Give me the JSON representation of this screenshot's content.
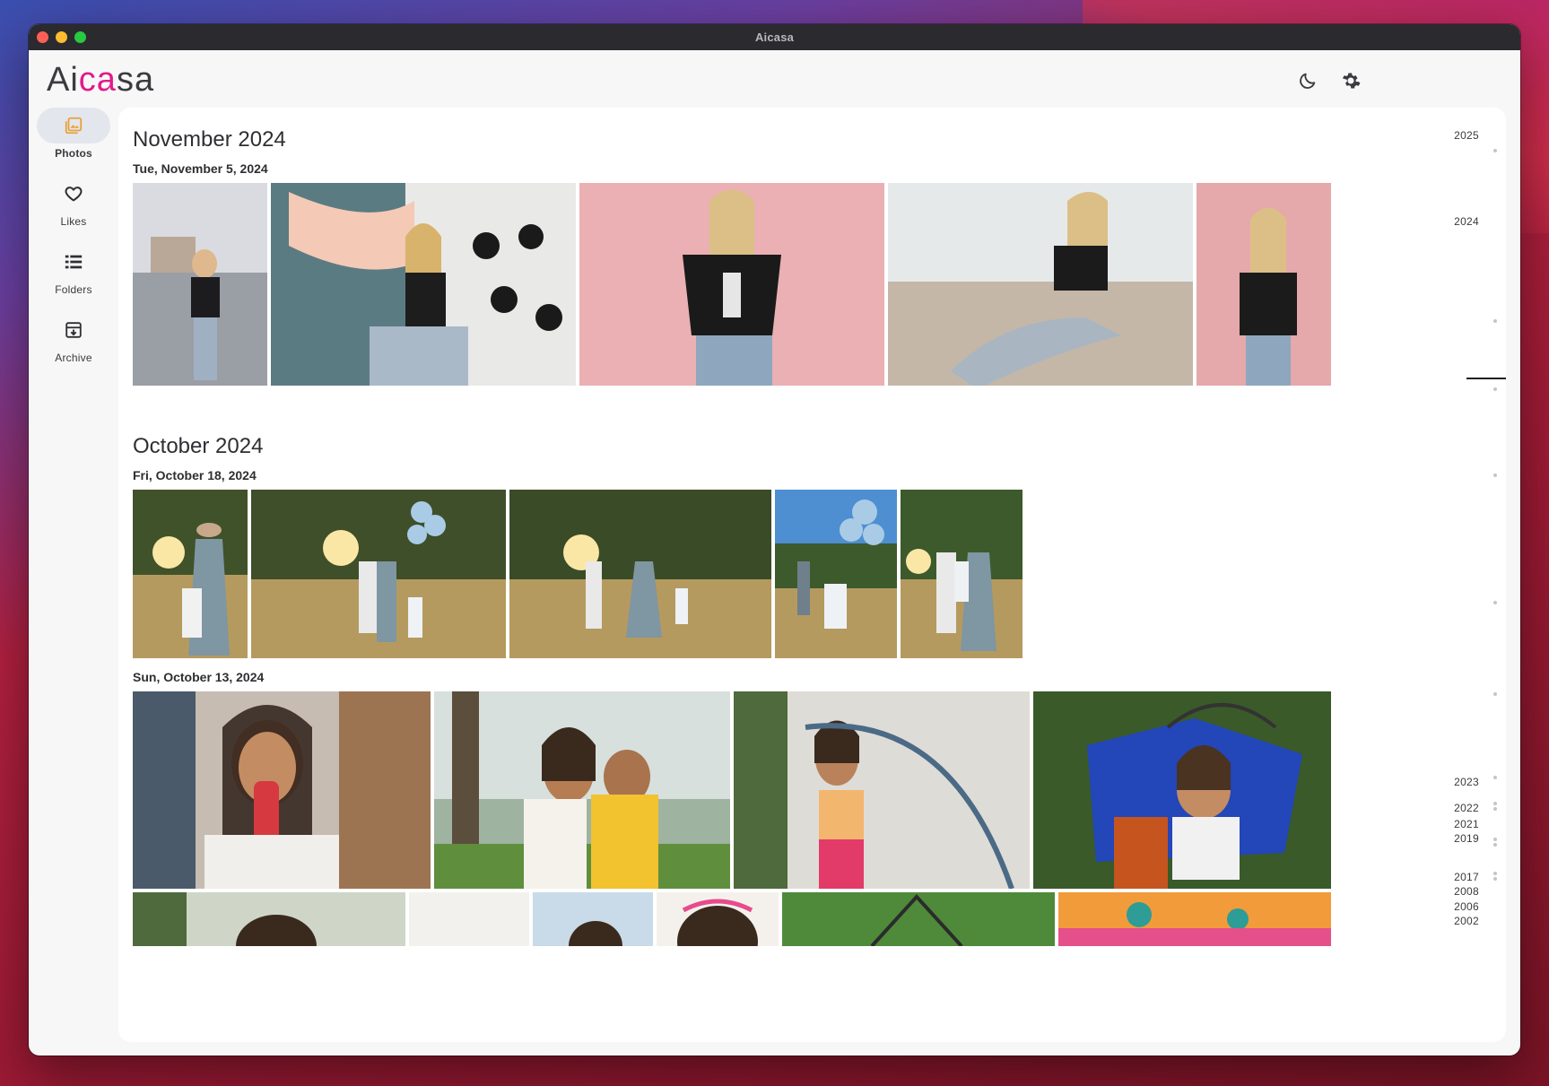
{
  "window": {
    "title": "Aicasa"
  },
  "app": {
    "logo": {
      "part1": "Ai",
      "part2": "ca",
      "part3": "sa"
    },
    "actions": [
      {
        "icon": "moon-icon"
      },
      {
        "icon": "gear-icon"
      }
    ]
  },
  "nav": {
    "items": [
      {
        "label": "Photos",
        "icon": "photos-icon",
        "active": true
      },
      {
        "label": "Likes",
        "icon": "heart-icon",
        "active": false
      },
      {
        "label": "Folders",
        "icon": "list-icon",
        "active": false
      },
      {
        "label": "Archive",
        "icon": "archive-icon",
        "active": false
      }
    ]
  },
  "timeline": {
    "sections": [
      {
        "month": "November 2024",
        "days": [
          {
            "date": "Tue, November 5, 2024"
          }
        ]
      },
      {
        "month": "October 2024",
        "days": [
          {
            "date": "Fri, October 18, 2024"
          },
          {
            "date": "Sun, October 13, 2024"
          }
        ]
      }
    ]
  },
  "scrubber": {
    "years": [
      "2025",
      "2024",
      "2023",
      "2022",
      "2021",
      "2019",
      "2017",
      "2008",
      "2006",
      "2002"
    ]
  },
  "colors": {
    "accent": "#e21a8a",
    "active_icon": "#e8a23a",
    "titlebar": "#2b2a2f"
  }
}
